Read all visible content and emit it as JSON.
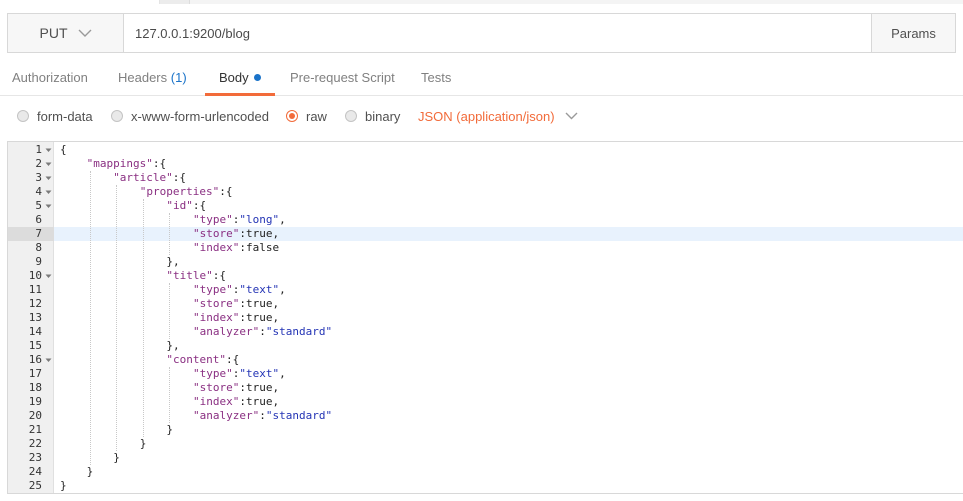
{
  "request": {
    "method": "PUT",
    "url": "127.0.0.1:9200/blog",
    "params_label": "Params"
  },
  "tabs": [
    {
      "label": "Authorization"
    },
    {
      "label": "Headers",
      "count": "(1)"
    },
    {
      "label": "Body"
    },
    {
      "label": "Pre-request Script"
    },
    {
      "label": "Tests"
    }
  ],
  "body_types": [
    {
      "label": "form-data",
      "selected": false
    },
    {
      "label": "x-www-form-urlencoded",
      "selected": false
    },
    {
      "label": "raw",
      "selected": true
    },
    {
      "label": "binary",
      "selected": false
    }
  ],
  "content_type": "JSON (application/json)",
  "editor": {
    "active_line": 7,
    "lines": [
      {
        "n": "1",
        "fold": true,
        "indent": 0,
        "tokens": [
          {
            "t": "p",
            "v": "{"
          }
        ]
      },
      {
        "n": "2",
        "fold": true,
        "indent": 1,
        "tokens": [
          {
            "t": "k",
            "v": "\"mappings\""
          },
          {
            "t": "p",
            "v": ":{"
          }
        ]
      },
      {
        "n": "3",
        "fold": true,
        "indent": 2,
        "tokens": [
          {
            "t": "k",
            "v": "\"article\""
          },
          {
            "t": "p",
            "v": ":{"
          }
        ]
      },
      {
        "n": "4",
        "fold": true,
        "indent": 3,
        "tokens": [
          {
            "t": "k",
            "v": "\"properties\""
          },
          {
            "t": "p",
            "v": ":{"
          }
        ]
      },
      {
        "n": "5",
        "fold": true,
        "indent": 4,
        "tokens": [
          {
            "t": "k",
            "v": "\"id\""
          },
          {
            "t": "p",
            "v": ":{"
          }
        ]
      },
      {
        "n": "6",
        "fold": false,
        "indent": 5,
        "tokens": [
          {
            "t": "k",
            "v": "\"type\""
          },
          {
            "t": "p",
            "v": ":"
          },
          {
            "t": "s",
            "v": "\"long\""
          },
          {
            "t": "p",
            "v": ","
          }
        ]
      },
      {
        "n": "7",
        "fold": false,
        "indent": 5,
        "tokens": [
          {
            "t": "k",
            "v": "\"store\""
          },
          {
            "t": "p",
            "v": ":true,"
          }
        ]
      },
      {
        "n": "8",
        "fold": false,
        "indent": 5,
        "tokens": [
          {
            "t": "k",
            "v": "\"index\""
          },
          {
            "t": "p",
            "v": ":false"
          }
        ]
      },
      {
        "n": "9",
        "fold": false,
        "indent": 4,
        "tokens": [
          {
            "t": "p",
            "v": "},"
          }
        ]
      },
      {
        "n": "10",
        "fold": true,
        "indent": 4,
        "tokens": [
          {
            "t": "k",
            "v": "\"title\""
          },
          {
            "t": "p",
            "v": ":{"
          }
        ]
      },
      {
        "n": "11",
        "fold": false,
        "indent": 5,
        "tokens": [
          {
            "t": "k",
            "v": "\"type\""
          },
          {
            "t": "p",
            "v": ":"
          },
          {
            "t": "s",
            "v": "\"text\""
          },
          {
            "t": "p",
            "v": ","
          }
        ]
      },
      {
        "n": "12",
        "fold": false,
        "indent": 5,
        "tokens": [
          {
            "t": "k",
            "v": "\"store\""
          },
          {
            "t": "p",
            "v": ":true,"
          }
        ]
      },
      {
        "n": "13",
        "fold": false,
        "indent": 5,
        "tokens": [
          {
            "t": "k",
            "v": "\"index\""
          },
          {
            "t": "p",
            "v": ":true,"
          }
        ]
      },
      {
        "n": "14",
        "fold": false,
        "indent": 5,
        "tokens": [
          {
            "t": "k",
            "v": "\"analyzer\""
          },
          {
            "t": "p",
            "v": ":"
          },
          {
            "t": "s",
            "v": "\"standard\""
          }
        ]
      },
      {
        "n": "15",
        "fold": false,
        "indent": 4,
        "tokens": [
          {
            "t": "p",
            "v": "},"
          }
        ]
      },
      {
        "n": "16",
        "fold": true,
        "indent": 4,
        "tokens": [
          {
            "t": "k",
            "v": "\"content\""
          },
          {
            "t": "p",
            "v": ":{"
          }
        ]
      },
      {
        "n": "17",
        "fold": false,
        "indent": 5,
        "tokens": [
          {
            "t": "k",
            "v": "\"type\""
          },
          {
            "t": "p",
            "v": ":"
          },
          {
            "t": "s",
            "v": "\"text\""
          },
          {
            "t": "p",
            "v": ","
          }
        ]
      },
      {
        "n": "18",
        "fold": false,
        "indent": 5,
        "tokens": [
          {
            "t": "k",
            "v": "\"store\""
          },
          {
            "t": "p",
            "v": ":true,"
          }
        ]
      },
      {
        "n": "19",
        "fold": false,
        "indent": 5,
        "tokens": [
          {
            "t": "k",
            "v": "\"index\""
          },
          {
            "t": "p",
            "v": ":true,"
          }
        ]
      },
      {
        "n": "20",
        "fold": false,
        "indent": 5,
        "tokens": [
          {
            "t": "k",
            "v": "\"analyzer\""
          },
          {
            "t": "p",
            "v": ":"
          },
          {
            "t": "s",
            "v": "\"standard\""
          }
        ]
      },
      {
        "n": "21",
        "fold": false,
        "indent": 4,
        "tokens": [
          {
            "t": "p",
            "v": "}"
          }
        ]
      },
      {
        "n": "22",
        "fold": false,
        "indent": 3,
        "tokens": [
          {
            "t": "p",
            "v": "}"
          }
        ]
      },
      {
        "n": "23",
        "fold": false,
        "indent": 2,
        "tokens": [
          {
            "t": "p",
            "v": "}"
          }
        ]
      },
      {
        "n": "24",
        "fold": false,
        "indent": 1,
        "tokens": [
          {
            "t": "p",
            "v": "}"
          }
        ]
      },
      {
        "n": "25",
        "fold": false,
        "indent": 0,
        "tokens": [
          {
            "t": "p",
            "v": "}"
          }
        ]
      }
    ]
  },
  "colors": {
    "accent": "#f26b3a",
    "link": "#1a73c9",
    "json_key": "#8a2f82",
    "json_string": "#2434b5",
    "active_line": "#e8f2fd"
  },
  "icons": {
    "method_dropdown": "chevron-down-icon",
    "content_type_dropdown": "chevron-down-icon",
    "fold": "fold-arrow-icon",
    "body_indicator": "dot-icon"
  }
}
